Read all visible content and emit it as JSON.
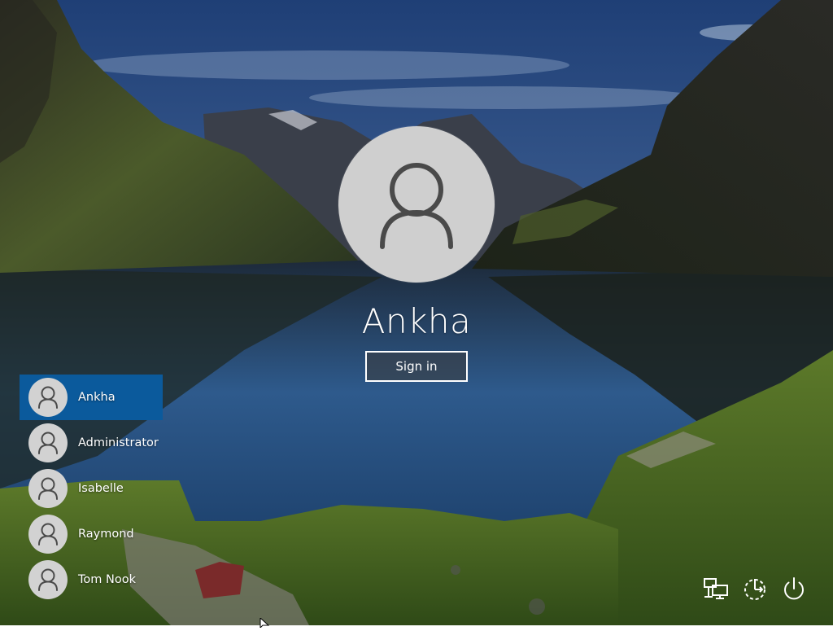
{
  "current_user": {
    "name": "Ankha",
    "sign_in_label": "Sign in",
    "avatar_icon": "user-icon"
  },
  "users": [
    {
      "name": "Ankha",
      "selected": true
    },
    {
      "name": "Administrator",
      "selected": false
    },
    {
      "name": "Isabelle",
      "selected": false
    },
    {
      "name": "Raymond",
      "selected": false
    },
    {
      "name": "Tom Nook",
      "selected": false
    }
  ],
  "system_buttons": [
    {
      "icon": "network-icon"
    },
    {
      "icon": "ease-of-access-icon"
    },
    {
      "icon": "power-icon"
    }
  ],
  "colors": {
    "selected_user_bg": "#0b5a9c",
    "avatar_bg": "#cfcfcf",
    "text": "#ffffff"
  }
}
